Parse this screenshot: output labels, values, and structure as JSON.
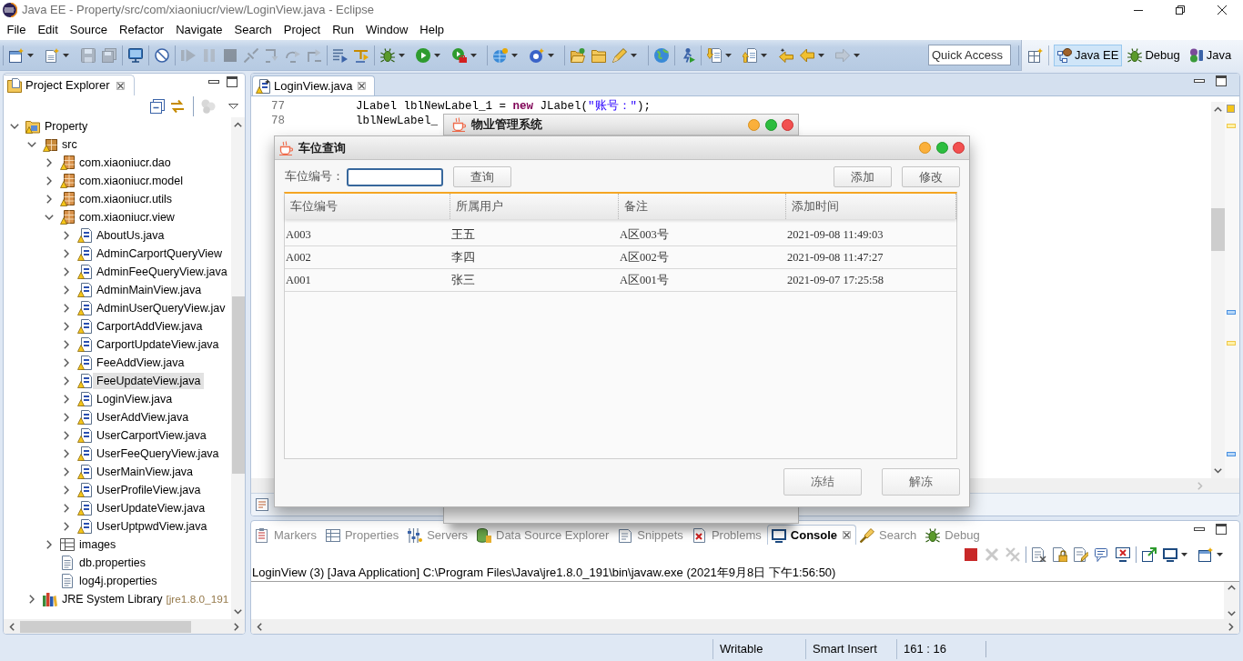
{
  "window": {
    "title": "Java EE - Property/src/com/xiaoniucr/view/LoginView.java - Eclipse"
  },
  "menu": [
    "File",
    "Edit",
    "Source",
    "Refactor",
    "Navigate",
    "Search",
    "Project",
    "Run",
    "Window",
    "Help"
  ],
  "toolbar": [
    {
      "disabled": false
    },
    {
      "disabled": false
    },
    {
      "disabled": true
    },
    {
      "disabled": true
    },
    {
      "disabled": false
    },
    {
      "disabled": false
    },
    {
      "disabled": true
    },
    {
      "disabled": true
    },
    {
      "disabled": true
    },
    {
      "disabled": true
    },
    {
      "disabled": true
    },
    {
      "disabled": true
    },
    {
      "disabled": true
    },
    {
      "disabled": false
    },
    {
      "disabled": false
    },
    {
      "disabled": false
    },
    {
      "disabled": false
    },
    {
      "disabled": false
    },
    {
      "disabled": false
    },
    {
      "disabled": false
    },
    {
      "disabled": false
    },
    {
      "disabled": false
    },
    {
      "disabled": false
    },
    {
      "disabled": false
    },
    {
      "disabled": false
    },
    {
      "disabled": false
    },
    {
      "disabled": false
    },
    {
      "disabled": false
    },
    {
      "disabled": false
    },
    {
      "disabled": true
    }
  ],
  "quick_access": {
    "placeholder": "Quick Access"
  },
  "perspectives": [
    {
      "label": "Java EE",
      "selected": true
    },
    {
      "label": "Debug",
      "selected": false
    },
    {
      "label": "Java",
      "selected": false
    }
  ],
  "project_explorer": {
    "tab": "Project Explorer",
    "toolbar": [
      {
        "disabled": false
      },
      {
        "disabled": false
      },
      {
        "disabled": true
      },
      {
        "disabled": false
      }
    ],
    "tree": [
      {
        "label": "Property",
        "kind": "project",
        "expanded": true,
        "selected": false,
        "children": [
          {
            "label": "src",
            "kind": "source-folder",
            "expanded": true,
            "selected": false,
            "children": [
              {
                "label": "com.xiaoniucr.dao",
                "kind": "package",
                "expanded": false,
                "selected": false
              },
              {
                "label": "com.xiaoniucr.model",
                "kind": "package",
                "expanded": false,
                "selected": false
              },
              {
                "label": "com.xiaoniucr.utils",
                "kind": "package",
                "expanded": false,
                "selected": false
              },
              {
                "label": "com.xiaoniucr.view",
                "kind": "package",
                "expanded": true,
                "selected": false,
                "children": [
                  {
                    "label": "AboutUs.java",
                    "kind": "java-file",
                    "expanded": false,
                    "selected": false
                  },
                  {
                    "label": "AdminCarportQueryView",
                    "kind": "java-file",
                    "expanded": false,
                    "selected": false
                  },
                  {
                    "label": "AdminFeeQueryView.java",
                    "kind": "java-file",
                    "expanded": false,
                    "selected": false
                  },
                  {
                    "label": "AdminMainView.java",
                    "kind": "java-file",
                    "expanded": false,
                    "selected": false
                  },
                  {
                    "label": "AdminUserQueryView.jav",
                    "kind": "java-file",
                    "expanded": false,
                    "selected": false
                  },
                  {
                    "label": "CarportAddView.java",
                    "kind": "java-file",
                    "expanded": false,
                    "selected": false
                  },
                  {
                    "label": "CarportUpdateView.java",
                    "kind": "java-file",
                    "expanded": false,
                    "selected": false
                  },
                  {
                    "label": "FeeAddView.java",
                    "kind": "java-file",
                    "expanded": false,
                    "selected": false
                  },
                  {
                    "label": "FeeUpdateView.java",
                    "kind": "java-file",
                    "expanded": false,
                    "selected": true
                  },
                  {
                    "label": "LoginView.java",
                    "kind": "java-file",
                    "expanded": false,
                    "selected": false
                  },
                  {
                    "label": "UserAddView.java",
                    "kind": "java-file",
                    "expanded": false,
                    "selected": false
                  },
                  {
                    "label": "UserCarportView.java",
                    "kind": "java-file",
                    "expanded": false,
                    "selected": false
                  },
                  {
                    "label": "UserFeeQueryView.java",
                    "kind": "java-file",
                    "expanded": false,
                    "selected": false
                  },
                  {
                    "label": "UserMainView.java",
                    "kind": "java-file",
                    "expanded": false,
                    "selected": false
                  },
                  {
                    "label": "UserProfileView.java",
                    "kind": "java-file",
                    "expanded": false,
                    "selected": false
                  },
                  {
                    "label": "UserUpdateView.java",
                    "kind": "java-file",
                    "expanded": false,
                    "selected": false
                  },
                  {
                    "label": "UserUptpwdView.java",
                    "kind": "java-file",
                    "expanded": false,
                    "selected": false
                  }
                ]
              },
              {
                "label": "images",
                "kind": "folder",
                "expanded": false,
                "selected": false
              },
              {
                "label": "db.properties",
                "kind": "properties-file",
                "selected": false
              },
              {
                "label": "log4j.properties",
                "kind": "properties-file",
                "selected": false
              }
            ]
          },
          {
            "label": "JRE System Library",
            "decoration": "[jre1.8.0_191",
            "kind": "library",
            "expanded": false,
            "selected": false
          }
        ]
      }
    ]
  },
  "editor": {
    "tab": "LoginView.java",
    "lines": [
      {
        "number": "77",
        "tokens": [
          {
            "kind": "plain",
            "text": "JLabel lblNewLabel_1 = "
          },
          {
            "kind": "keyword",
            "text": "new"
          },
          {
            "kind": "plain",
            "text": " JLabel("
          },
          {
            "kind": "string",
            "text": "\"账号：\""
          },
          {
            "kind": "plain",
            "text": ");"
          }
        ]
      },
      {
        "number": "78",
        "tokens": [
          {
            "kind": "plain",
            "text": "lblNewLabel_"
          }
        ]
      }
    ]
  },
  "console": {
    "tabs": [
      {
        "label": "Markers",
        "selected": false
      },
      {
        "label": "Properties",
        "selected": false
      },
      {
        "label": "Servers",
        "selected": false
      },
      {
        "label": "Data Source Explorer",
        "selected": false
      },
      {
        "label": "Snippets",
        "selected": false
      },
      {
        "label": "Problems",
        "selected": false
      },
      {
        "label": "Console",
        "selected": true
      },
      {
        "label": "Search",
        "selected": false
      },
      {
        "label": "Debug",
        "selected": false
      }
    ],
    "toolbar": [
      {
        "disabled": false
      },
      {
        "disabled": true
      },
      {
        "disabled": true
      },
      {
        "disabled": false
      },
      {
        "disabled": false
      },
      {
        "disabled": false
      },
      {
        "disabled": false
      },
      {
        "disabled": false
      },
      {
        "disabled": false
      },
      {
        "disabled": false
      },
      {
        "disabled": false
      }
    ],
    "output": "LoginView (3) [Java Application] C:\\Program Files\\Java\\jre1.8.0_191\\bin\\javaw.exe (2021年9月8日 下午1:56:50)"
  },
  "status_bar": [
    "Writable",
    "Smart Insert",
    "161 : 16"
  ],
  "dialogs": [
    {
      "title": "物业管理系统"
    },
    {
      "title": "车位查询",
      "filter_label": "车位编号：",
      "filter_field": {
        "focused": true
      },
      "search_button": "查询",
      "actions": [
        "添加",
        "修改"
      ],
      "table": {
        "columns": [
          "车位编号",
          "所属用户",
          "备注",
          "添加时间"
        ],
        "rows": [
          [
            "A003",
            "王五",
            "A区003号",
            "2021-09-08 11:49:03"
          ],
          [
            "A002",
            "李四",
            "A区002号",
            "2021-09-08 11:47:27"
          ],
          [
            "A001",
            "张三",
            "A区001号",
            "2021-09-07 17:25:58"
          ]
        ]
      },
      "footer_buttons": [
        "冻结",
        "解冻"
      ]
    }
  ]
}
